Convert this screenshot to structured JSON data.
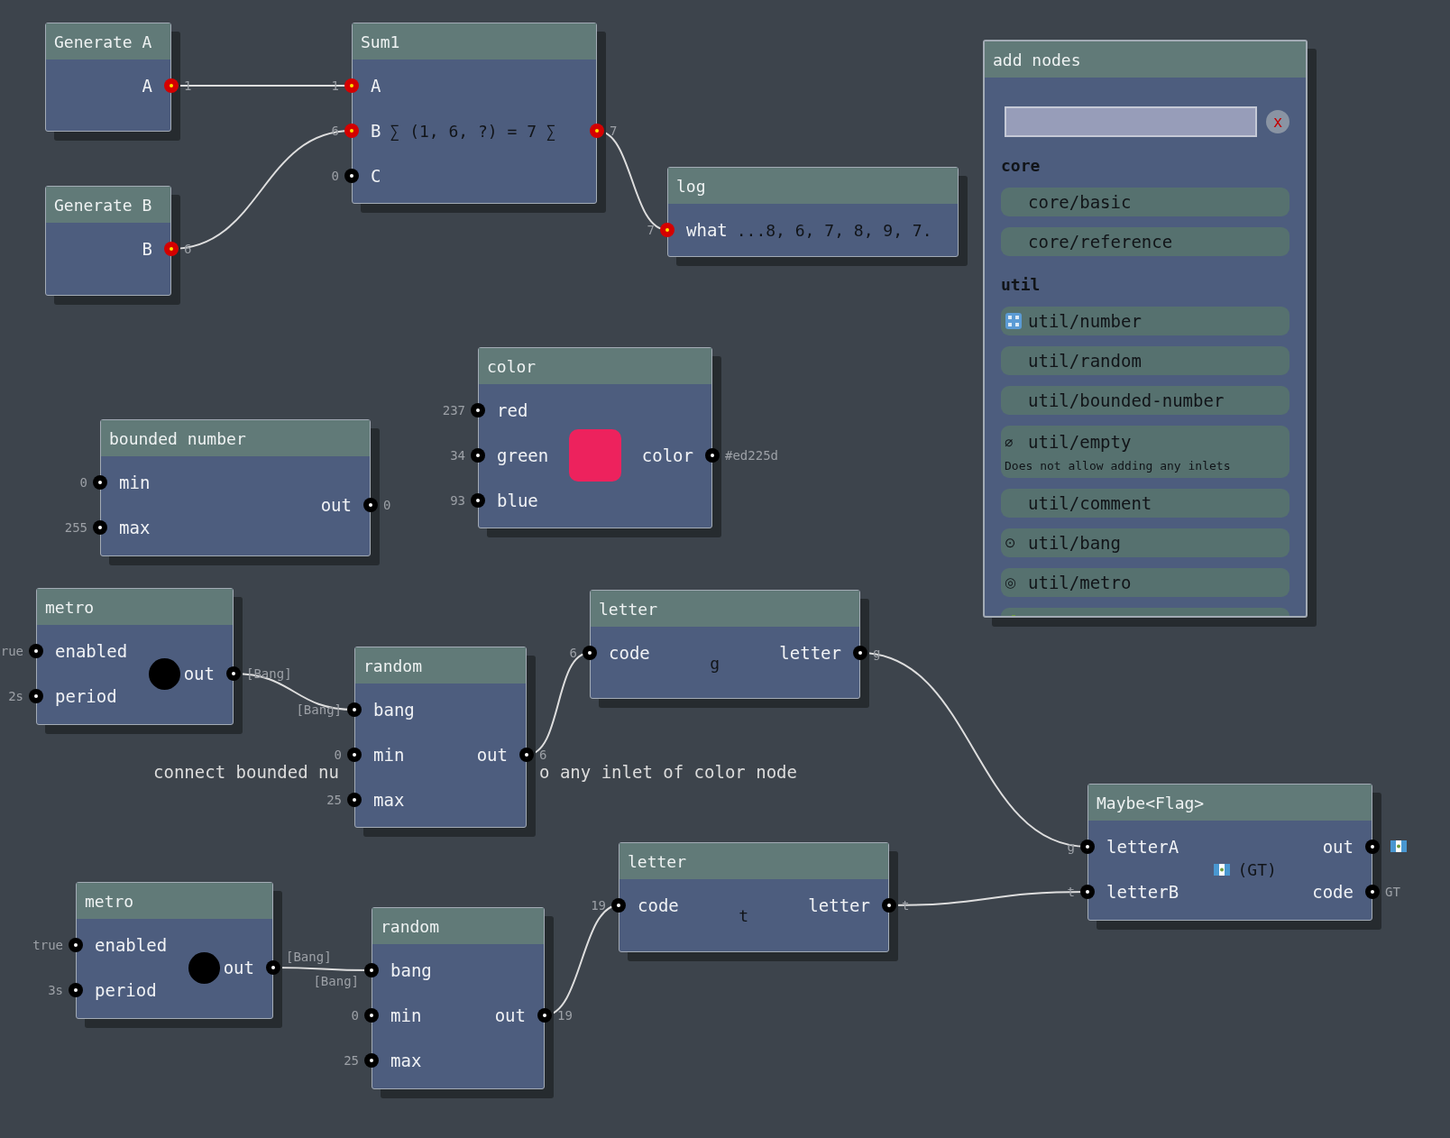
{
  "nodes": [
    {
      "title": "Generate A",
      "outlets": [
        {
          "label": "A",
          "value": "1",
          "active": true
        }
      ]
    },
    {
      "title": "Generate B",
      "outlets": [
        {
          "label": "B",
          "value": "6",
          "active": true
        }
      ]
    },
    {
      "title": "Sum1",
      "inlets": [
        {
          "label": "A",
          "value": "1",
          "active": true
        },
        {
          "label": "B",
          "value": "6",
          "active": true
        },
        {
          "label": "C",
          "value": "0",
          "active": false
        }
      ],
      "outlets": [
        {
          "value": "7",
          "active": true
        }
      ],
      "display": {
        "kind": "text",
        "text": "∑ (1, 6, ?) = 7 ∑"
      }
    },
    {
      "title": "log",
      "inlets": [
        {
          "label": "what",
          "value": "7",
          "active": true
        }
      ],
      "display": {
        "kind": "text",
        "text": "...8, 6, 7, 8, 9, 7."
      }
    },
    {
      "title": "color",
      "inlets": [
        {
          "label": "red",
          "value": "237",
          "active": false
        },
        {
          "label": "green",
          "value": "34",
          "active": false
        },
        {
          "label": "blue",
          "value": "93",
          "active": false
        }
      ],
      "outlets": [
        {
          "label": "color",
          "value": "#ed225d",
          "active": false
        }
      ],
      "display": {
        "kind": "swatch",
        "color": "#ed225d"
      }
    },
    {
      "title": "bounded number",
      "inlets": [
        {
          "label": "min",
          "value": "0",
          "active": false
        },
        {
          "label": "max",
          "value": "255",
          "active": false
        }
      ],
      "outlets": [
        {
          "label": "out",
          "value": "0",
          "active": false
        }
      ]
    },
    {
      "title": "metro",
      "inlets": [
        {
          "label": "enabled",
          "value": "rue",
          "active": false
        },
        {
          "label": "period",
          "value": "2s",
          "active": false
        }
      ],
      "outlets": [
        {
          "label": "out",
          "value": "[Bang]",
          "active": false
        }
      ],
      "display": {
        "kind": "bang"
      }
    },
    {
      "title": "random",
      "inlets": [
        {
          "label": "bang",
          "value": "[Bang]",
          "active": false
        },
        {
          "label": "min",
          "value": "0",
          "active": false
        },
        {
          "label": "max",
          "value": "25",
          "active": false
        }
      ],
      "outlets": [
        {
          "label": "out",
          "value": "6",
          "active": false
        }
      ]
    },
    {
      "title": "letter",
      "inlets": [
        {
          "label": "code",
          "value": "6",
          "active": false
        }
      ],
      "outlets": [
        {
          "label": "letter",
          "value": "g",
          "active": false
        }
      ],
      "display": {
        "kind": "letter",
        "text": "g"
      }
    },
    {
      "title": "Maybe<Flag>",
      "inlets": [
        {
          "label": "letterA",
          "value": "g",
          "active": false
        },
        {
          "label": "letterB",
          "value": "t",
          "active": false
        }
      ],
      "outlets": [
        {
          "kind": "flag",
          "label": "out",
          "active": false
        },
        {
          "kind": "text",
          "label": "code",
          "value": "GT",
          "active": false
        }
      ],
      "display": {
        "kind": "flag",
        "text": "(GT)"
      }
    },
    {
      "title": "letter",
      "inlets": [
        {
          "label": "code",
          "value": "19",
          "active": false
        }
      ],
      "outlets": [
        {
          "label": "letter",
          "value": "t",
          "active": false
        }
      ],
      "display": {
        "kind": "letter",
        "text": "t"
      }
    },
    {
      "title": "metro",
      "inlets": [
        {
          "label": "enabled",
          "value": "true",
          "active": false
        },
        {
          "label": "period",
          "value": "3s",
          "active": false
        }
      ],
      "outlets": [
        {
          "label": "out",
          "value": "[Bang]",
          "active": false
        }
      ],
      "display": {
        "kind": "bang"
      }
    },
    {
      "title": "random",
      "inlets": [
        {
          "label": "bang",
          "value": "[Bang]",
          "active": false
        },
        {
          "label": "min",
          "value": "0",
          "active": false
        },
        {
          "label": "max",
          "value": "25",
          "active": false
        }
      ],
      "outlets": [
        {
          "label": "out",
          "value": "19",
          "active": false
        }
      ]
    }
  ],
  "comment": [
    "connect bounded nu",
    "o any inlet of color node"
  ],
  "add_nodes": {
    "title": "add nodes",
    "clear_label": "x",
    "groups": [
      {
        "name": "core",
        "items": [
          {
            "kind": "plain",
            "label": "core/basic"
          },
          {
            "kind": "plain",
            "label": "core/reference"
          }
        ]
      },
      {
        "name": "util",
        "items": [
          {
            "kind": "number",
            "label": "util/number"
          },
          {
            "kind": "plain",
            "label": "util/random"
          },
          {
            "kind": "plain",
            "label": "util/bounded-number"
          },
          {
            "kind": "glyph",
            "label": "util/empty",
            "glyph": "⌀",
            "description": "Does not allow adding any inlets"
          },
          {
            "kind": "plain",
            "label": "util/comment"
          },
          {
            "kind": "glyph",
            "label": "util/bang",
            "glyph": "⊙"
          },
          {
            "kind": "glyph",
            "label": "util/metro",
            "glyph": "◎"
          },
          {
            "kind": "color"
          }
        ]
      }
    ]
  }
}
